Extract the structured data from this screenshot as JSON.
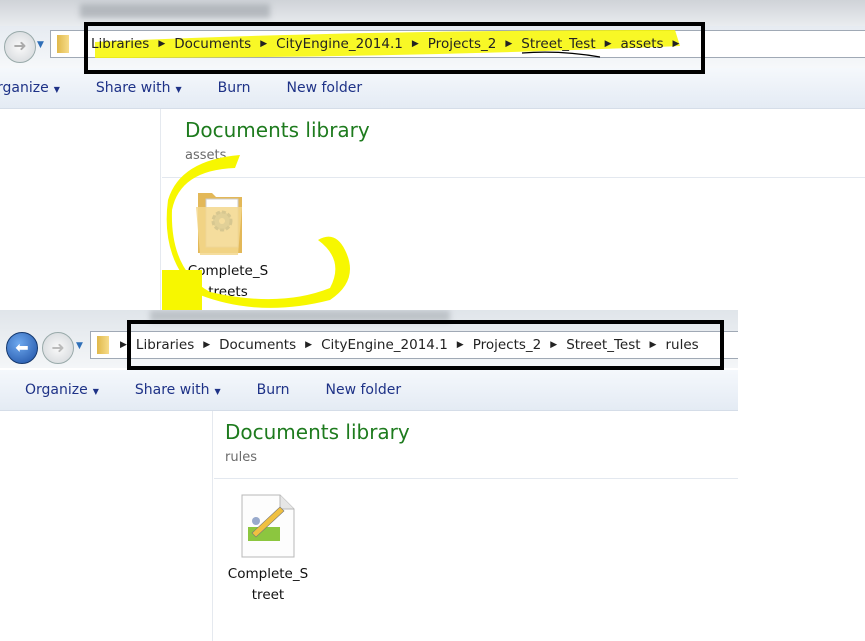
{
  "top_window": {
    "breadcrumb": [
      "Libraries",
      "Documents",
      "CityEngine_2014.1",
      "Projects_2",
      "Street_Test",
      "assets"
    ],
    "toolbar": {
      "organize": "Organize",
      "share_with": "Share with",
      "burn": "Burn",
      "new_folder": "New folder"
    },
    "library_title": "Documents library",
    "library_subtitle": "assets",
    "items": [
      {
        "name_line1": "Complete_S",
        "name_line2": "treets",
        "icon": "folder-gear-icon"
      }
    ]
  },
  "bottom_window": {
    "breadcrumb": [
      "Libraries",
      "Documents",
      "CityEngine_2014.1",
      "Projects_2",
      "Street_Test",
      "rules"
    ],
    "toolbar": {
      "organize": "Organize",
      "share_with": "Share with",
      "burn": "Burn",
      "new_folder": "New folder"
    },
    "library_title": "Documents library",
    "library_subtitle": "rules",
    "items": [
      {
        "name_line1": "Complete_S",
        "name_line2": "treet",
        "icon": "rule-file-icon"
      }
    ]
  },
  "annotations": {
    "highlight_color": "#f7f700",
    "box_color": "#000000"
  }
}
